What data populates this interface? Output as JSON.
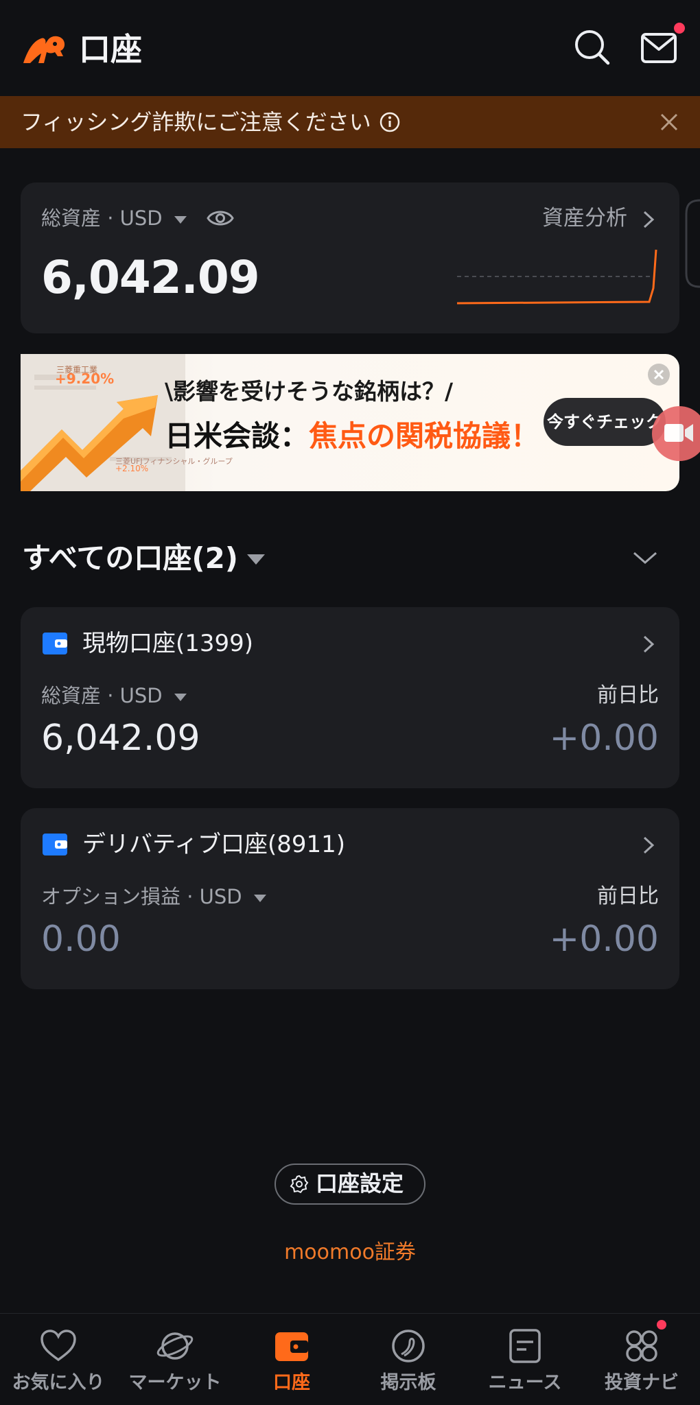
{
  "header": {
    "title": "口座",
    "icons": [
      "moomoo-logo-icon",
      "search-icon",
      "mail-icon"
    ]
  },
  "warning": {
    "text": "フィッシング詐欺にご注意ください",
    "icons": [
      "info-icon",
      "close-icon"
    ]
  },
  "total": {
    "label": "総資産 · USD",
    "value": "6,042.09",
    "analysis_link": "資産分析"
  },
  "ad": {
    "subtitle": "\\影響を受けそうな銘柄は？/",
    "title_main": "日米会談：",
    "title_highlight": "焦点の関税協議！",
    "cta": "今すぐチェック",
    "stock1_name": "三菱重工業",
    "stock1_change": "+9.20%",
    "stock2_name": "三菱UFJフィナンシャル・グループ",
    "stock2_change": "+2.10%"
  },
  "accounts_section": {
    "title": "すべての口座(2)"
  },
  "accounts": [
    {
      "name": "現物口座(1399)",
      "label": "総資産 · USD",
      "value": "6,042.09",
      "change_label": "前日比",
      "change": "+0.00"
    },
    {
      "name": "デリバティブ口座(8911)",
      "label": "オプション損益 · USD",
      "value": "0.00",
      "change_label": "前日比",
      "change": "+0.00"
    }
  ],
  "settings": {
    "label": "口座設定"
  },
  "brand": "moomoo証券",
  "bottom_nav": {
    "items": [
      {
        "label": "お気に入り",
        "icon": "heart-icon"
      },
      {
        "label": "マーケット",
        "icon": "planet-icon"
      },
      {
        "label": "口座",
        "icon": "wallet-icon"
      },
      {
        "label": "掲示板",
        "icon": "chat-swirl-icon"
      },
      {
        "label": "ニュース",
        "icon": "news-icon"
      },
      {
        "label": "投資ナビ",
        "icon": "grid-icon"
      }
    ],
    "active_index": 2
  },
  "colors": {
    "accent": "#ff6a1a",
    "background": "#101114",
    "card": "#1d1e22",
    "warning_bg": "#55290a",
    "badge": "#ff3b5c"
  }
}
